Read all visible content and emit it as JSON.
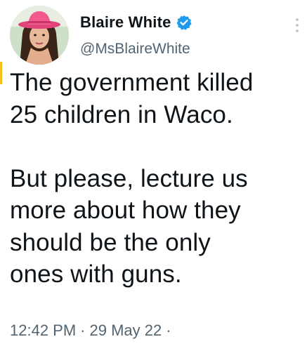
{
  "user": {
    "display_name": "Blaire White",
    "handle": "@MsBlaireWhite",
    "verified_icon": "verified-badge-icon",
    "avatar_icon": "profile-avatar"
  },
  "tweet": {
    "text": "The government killed\n25 children in Waco.\n\nBut please, lecture us\nmore about how they\nshould be the only\nones with guns."
  },
  "meta": {
    "time": "12:42 PM",
    "separator": "·",
    "date": "29 May 22",
    "trailing_separator": "·"
  },
  "colors": {
    "text": "#0f1419",
    "secondary": "#536471",
    "verified": "#1d9bf0"
  }
}
